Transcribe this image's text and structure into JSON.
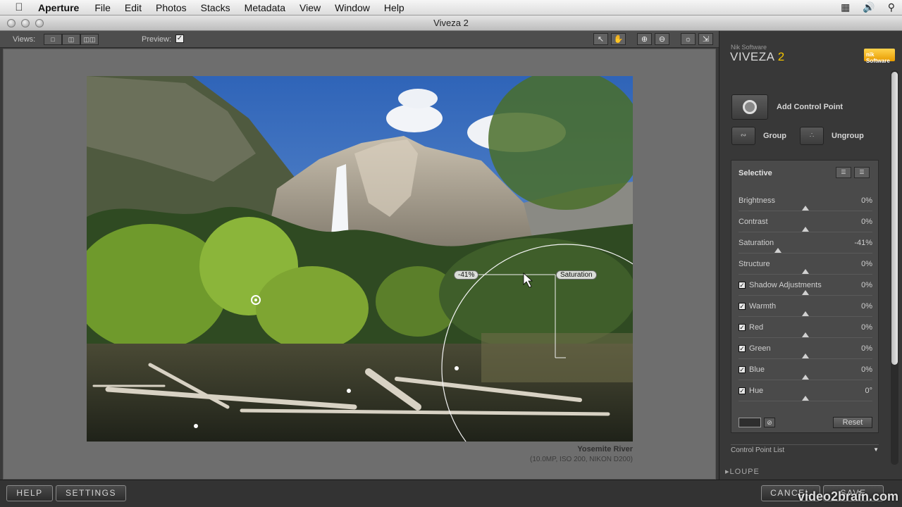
{
  "menubar": {
    "app": "Aperture",
    "menus": [
      "File",
      "Edit",
      "Photos",
      "Stacks",
      "Metadata",
      "View",
      "Window",
      "Help"
    ]
  },
  "window": {
    "title": "Viveza 2"
  },
  "toolbar": {
    "views_label": "Views:",
    "preview_label": "Preview:",
    "preview_checked": true
  },
  "photo": {
    "title": "Yosemite River",
    "meta": "(10.0MP, ISO 200, NIKON D200)",
    "control_point": {
      "value_tag": "-41%",
      "name_tag": "Saturation"
    }
  },
  "panel": {
    "brand_small": "Nik Software",
    "brand": "VIVEZA",
    "brand_version": "2",
    "nik_logo": "nik Software",
    "add_control_point": "Add Control Point",
    "group": "Group",
    "ungroup": "Ungroup",
    "selective": {
      "title": "Selective",
      "sliders": [
        {
          "name": "Brightness",
          "value": "0%",
          "checkbox": false,
          "level": 0
        },
        {
          "name": "Contrast",
          "value": "0%",
          "checkbox": false,
          "level": 0
        },
        {
          "name": "Saturation",
          "value": "-41%",
          "checkbox": false,
          "level": -41
        },
        {
          "name": "Structure",
          "value": "0%",
          "checkbox": false,
          "level": 0
        },
        {
          "name": "Shadow Adjustments",
          "value": "0%",
          "checkbox": true,
          "level": 0
        },
        {
          "name": "Warmth",
          "value": "0%",
          "checkbox": true,
          "level": 0
        },
        {
          "name": "Red",
          "value": "0%",
          "checkbox": true,
          "level": 0
        },
        {
          "name": "Green",
          "value": "0%",
          "checkbox": true,
          "level": 0
        },
        {
          "name": "Blue",
          "value": "0%",
          "checkbox": true,
          "level": 0
        },
        {
          "name": "Hue",
          "value": "0°",
          "checkbox": true,
          "level": 0
        }
      ],
      "reset": "Reset"
    },
    "control_point_list": "Control Point List",
    "loupe": "LOUPE"
  },
  "bottom": {
    "help": "HELP",
    "settings": "SETTINGS",
    "cancel": "CANCEL",
    "save": "SAVE",
    "watermark": "video2brain.com"
  },
  "colors": {
    "accent_yellow": "#f2c200",
    "panel_bg": "#383838",
    "canvas_bg": "#6e6e6e"
  }
}
